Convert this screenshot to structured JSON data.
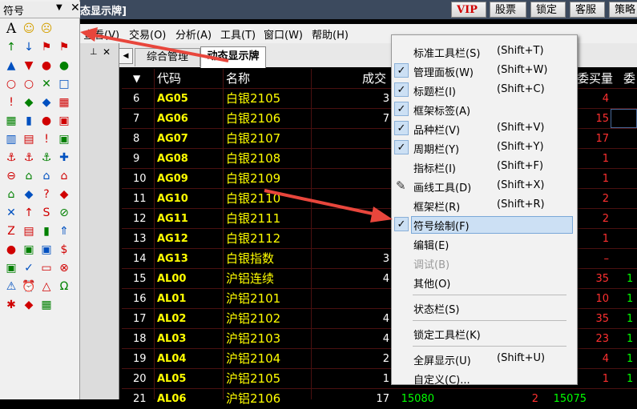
{
  "window": {
    "title": "态显示牌]"
  },
  "toolbar_buttons": [
    "VIP",
    "股票池",
    "锁定",
    "客服",
    "策略库"
  ],
  "menubar": [
    "查看(V)",
    "交易(O)",
    "分析(A)",
    "工具(T)",
    "窗口(W)",
    "帮助(H)"
  ],
  "palette": {
    "title": "符号",
    "dropdown_glyph": "▼",
    "close_glyph": "✕",
    "icons": [
      [
        "A",
        "☺",
        "☹"
      ],
      [
        "↑",
        "↓",
        "⚑",
        "⚑"
      ],
      [
        "▲",
        "▼",
        "●",
        "●"
      ],
      [
        "○",
        "○",
        "✕",
        "□"
      ],
      [
        "!",
        "◆",
        "◆",
        "▦"
      ],
      [
        "▦",
        "▮",
        "●",
        "▣"
      ],
      [
        "▥",
        "▤",
        "!",
        "▣"
      ],
      [
        "⚓",
        "⚓",
        "⚓",
        "✚"
      ],
      [
        "⊖",
        "⌂",
        "⌂",
        "⌂"
      ],
      [
        "⌂",
        "◆",
        "?",
        "◆"
      ],
      [
        "✕",
        "↑",
        "S",
        "⊘"
      ],
      [
        "Z",
        "▤",
        "▮",
        "⇑"
      ],
      [
        "●",
        "▣",
        "▣",
        "$"
      ],
      [
        "▣",
        "✓",
        "▭",
        "⊗"
      ],
      [
        "⚠",
        "⏰",
        "△",
        "Ω"
      ],
      [
        "✱",
        "◆",
        "▦"
      ]
    ]
  },
  "tabs": {
    "dock_pin": "⊥",
    "dock_close": "✕",
    "scroll_left": "◀",
    "items": [
      "综合管理",
      "动态显示牌"
    ],
    "active": 1
  },
  "grid": {
    "sort_glyph": "▼",
    "headers": [
      "代码",
      "名称",
      "成交",
      "委买量",
      "委"
    ],
    "rows": [
      {
        "no": "6",
        "code": "AG05",
        "name": "白银2105",
        "c1": "3",
        "buy": "4"
      },
      {
        "no": "7",
        "code": "AG06",
        "name": "白银2106",
        "c1": "7",
        "buy": "15"
      },
      {
        "no": "8",
        "code": "AG07",
        "name": "白银2107",
        "c1": "",
        "buy": "17"
      },
      {
        "no": "9",
        "code": "AG08",
        "name": "白银2108",
        "c1": "",
        "buy": "1"
      },
      {
        "no": "10",
        "code": "AG09",
        "name": "白银2109",
        "c1": "",
        "buy": "1"
      },
      {
        "no": "11",
        "code": "AG10",
        "name": "白银2110",
        "c1": "",
        "buy": "2"
      },
      {
        "no": "12",
        "code": "AG11",
        "name": "白银2111",
        "c1": "",
        "buy": "2"
      },
      {
        "no": "13",
        "code": "AG12",
        "name": "白银2112",
        "c1": "",
        "buy": "1"
      },
      {
        "no": "14",
        "code": "AG13",
        "name": "白银指数",
        "c1": "3",
        "buy": "–"
      },
      {
        "no": "15",
        "code": "AL00",
        "name": "沪铝连续",
        "c1": "4",
        "buy": "35"
      },
      {
        "no": "16",
        "code": "AL01",
        "name": "沪铝2101",
        "c1": "",
        "buy": "10"
      },
      {
        "no": "17",
        "code": "AL02",
        "name": "沪铝2102",
        "c1": "4",
        "buy": "35"
      },
      {
        "no": "18",
        "code": "AL03",
        "name": "沪铝2103",
        "c1": "4",
        "buy": "23"
      },
      {
        "no": "19",
        "code": "AL04",
        "name": "沪铝2104",
        "c1": "2",
        "buy": "4"
      },
      {
        "no": "20",
        "code": "AL05",
        "name": "沪铝2105",
        "c1": "1",
        "buy": "1"
      },
      {
        "no": "21",
        "code": "AL06",
        "name": "沪铝2106",
        "c1": "17",
        "buy": ""
      }
    ],
    "bottom_partial": [
      "15080",
      "2",
      "15075"
    ]
  },
  "context_menu": {
    "items": [
      {
        "label": "标准工具栏(S)",
        "shortcut": "(Shift+T)",
        "checked": false,
        "disabled": false
      },
      {
        "label": "管理面板(W)",
        "shortcut": "(Shift+W)",
        "checked": true,
        "disabled": false
      },
      {
        "label": "标题栏(I)",
        "shortcut": "(Shift+C)",
        "checked": true,
        "disabled": false
      },
      {
        "label": "框架标签(A)",
        "shortcut": "",
        "checked": true,
        "disabled": false
      },
      {
        "label": "品种栏(V)",
        "shortcut": "(Shift+V)",
        "checked": true,
        "disabled": false
      },
      {
        "label": "周期栏(Y)",
        "shortcut": "(Shift+Y)",
        "checked": true,
        "disabled": false
      },
      {
        "label": "指标栏(I)",
        "shortcut": "(Shift+F)",
        "checked": false,
        "disabled": false
      },
      {
        "label": "画线工具(D)",
        "shortcut": "(Shift+X)",
        "checked": false,
        "disabled": false,
        "icon": "✎"
      },
      {
        "label": "框架栏(R)",
        "shortcut": "(Shift+R)",
        "checked": false,
        "disabled": false
      },
      {
        "label": "符号绘制(F)",
        "shortcut": "",
        "checked": true,
        "disabled": false,
        "highlighted": true
      },
      {
        "label": "编辑(E)",
        "shortcut": "",
        "checked": false,
        "disabled": false
      },
      {
        "label": "调试(B)",
        "shortcut": "",
        "checked": false,
        "disabled": true
      },
      {
        "label": "其他(O)",
        "shortcut": "",
        "checked": false,
        "disabled": false
      },
      {
        "label": "状态栏(S)",
        "shortcut": "",
        "checked": false,
        "disabled": false
      },
      {
        "label": "锁定工具栏(K)",
        "shortcut": "",
        "checked": false,
        "disabled": false
      },
      {
        "label": "全屏显示(U)",
        "shortcut": "(Shift+U)",
        "checked": false,
        "disabled": false
      },
      {
        "label": "自定义(C)...",
        "shortcut": "",
        "checked": false,
        "disabled": false
      }
    ],
    "check_glyph": "✓"
  },
  "colors": {
    "accent": "#cce0f4",
    "highlight": "#cce0f4",
    "arrow": "#e8463c"
  }
}
